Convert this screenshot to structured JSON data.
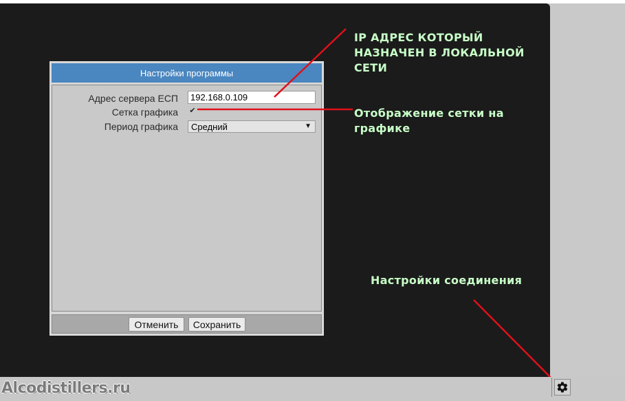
{
  "dialog": {
    "title": "Настройки программы",
    "fields": {
      "server_label": "Адрес сервера ЕСП",
      "server_value": "192.168.0.109",
      "grid_label": "Сетка графика",
      "grid_checked": true,
      "period_label": "Период графика",
      "period_value": "Средний"
    },
    "buttons": {
      "cancel": "Отменить",
      "save": "Сохранить"
    }
  },
  "annotations": {
    "ip_note": [
      "IP АДРЕС КОТОРЫЙ",
      "НАЗНАЧЕН В ЛОКАЛЬНОЙ",
      "СЕТИ"
    ],
    "grid_note": [
      "Отображение сетки на",
      "графике"
    ],
    "connection_note": "Настройки соединения"
  },
  "status_bar": {
    "watermark": "Alcodistillers.ru",
    "settings_icon": "gear-icon"
  },
  "colors": {
    "title_bar": "#4a86c0",
    "annotation_text": "#c8ffc8",
    "arrow": "#e0101a",
    "canvas": "#1b1b1b"
  }
}
